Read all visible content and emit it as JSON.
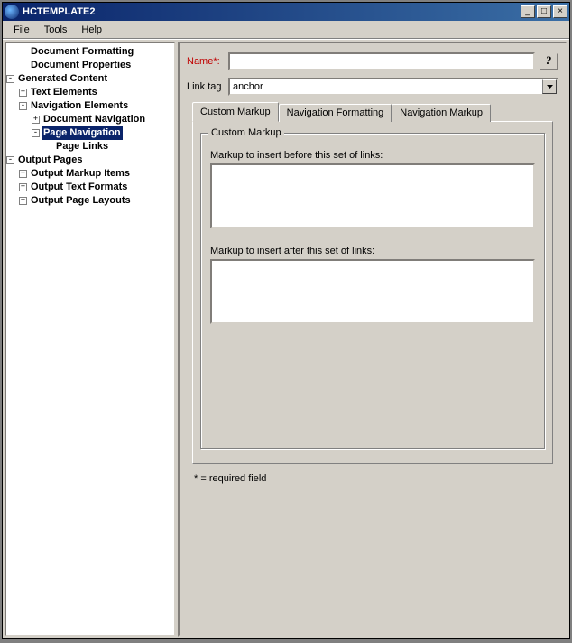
{
  "window": {
    "title": "HCTEMPLATE2"
  },
  "menu": {
    "file": "File",
    "tools": "Tools",
    "help": "Help"
  },
  "tree": {
    "doc_formatting": "Document Formatting",
    "doc_properties": "Document Properties",
    "generated_content": "Generated Content",
    "text_elements": "Text Elements",
    "navigation_elements": "Navigation Elements",
    "document_navigation": "Document Navigation",
    "page_navigation": "Page Navigation",
    "page_links": "Page Links",
    "output_pages": "Output Pages",
    "output_markup_items": "Output Markup Items",
    "output_text_formats": "Output Text Formats",
    "output_page_layouts": "Output Page Layouts"
  },
  "form": {
    "name_label": "Name*:",
    "name_value": "",
    "link_tag_label": "Link tag",
    "link_tag_value": "anchor"
  },
  "tabs": {
    "custom_markup": "Custom Markup",
    "nav_formatting": "Navigation Formatting",
    "nav_markup": "Navigation Markup"
  },
  "group": {
    "title": "Custom Markup",
    "before_label": "Markup to insert before this set of links:",
    "before_value": "",
    "after_label": "Markup to insert after this set of links:",
    "after_value": ""
  },
  "footer": {
    "required": "* = required field"
  }
}
